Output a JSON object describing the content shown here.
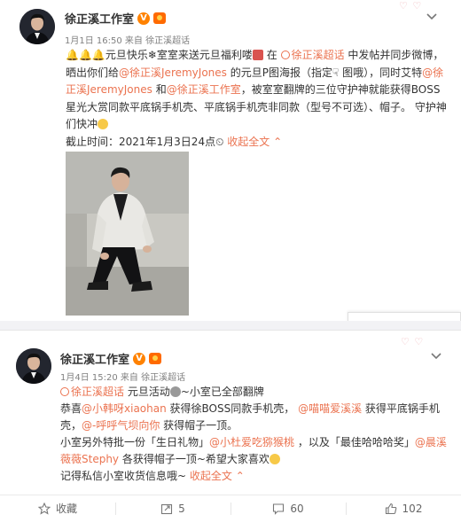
{
  "post1": {
    "author": "徐正溪工作室",
    "verified_mark": "V",
    "meta": "1月1日 16:50 来自 徐正溪超话",
    "text": {
      "p1": "元旦快乐",
      "p2": "室室来送元旦福利喽",
      "p3": " 在 ",
      "topic": "徐正溪超话",
      "p4": " 中发帖并同步微博，晒出你们给",
      "m1": "@徐正溪JeremyJones",
      "p5": " 的元旦P图海报（指定",
      "p6": " 图哦），同时艾特",
      "m2": "@徐正溪JeremyJones",
      "p7": " 和",
      "m3": "@徐正溪工作室",
      "p8": "，被室室翻牌的三位守护神就能获得BOSS星光大赏同款平底锅手机壳、平底锅手机壳非同款（型号不可选）、帽子。 守护神们快冲",
      "p9": "截止时间：2021年1月3日24点",
      "collapse": "收起全文"
    },
    "deco": "♡ ♡"
  },
  "post2": {
    "author": "徐正溪工作室",
    "verified_mark": "V",
    "meta": "1月4日 15:20 来自 徐正溪超话",
    "text": {
      "topic": "徐正溪超话",
      "p1": " 元旦活动",
      "p2": "~小室已全部翻牌",
      "l2a": "恭喜",
      "m1": "@小韩呀xiaohan",
      "l2b": " 获得徐BOSS同款手机壳， ",
      "m2": "@喵喵爱溪溪",
      "l2c": " 获得平底锅手机壳，",
      "m3": "@-呼呼气坝向你",
      "l2d": " 获得帽子一顶。",
      "l3a": "小室另外特批一份「生日礼物」",
      "m4": "@小杜爱吃猕猴桃",
      "l3b": " ，以及「最佳哈哈哈奖」",
      "m5": "@晨溪薇薇Stephy",
      "l3c": " 各获得帽子一顶~希望大家喜欢",
      "l4": "记得私信小室收货信息哦~ ",
      "collapse": "收起全文"
    },
    "deco": "♡ ♡",
    "actions": {
      "favorite": "收藏",
      "repost": "5",
      "comment": "60",
      "like": "102"
    }
  }
}
